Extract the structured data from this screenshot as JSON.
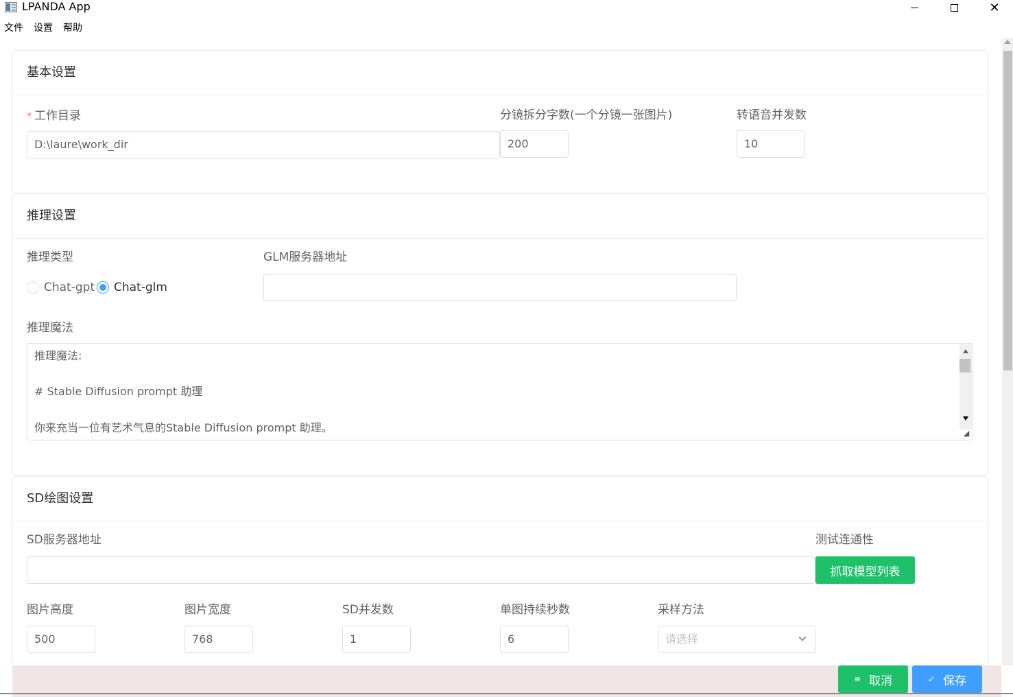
{
  "window": {
    "title": "LPANDA App"
  },
  "menu": [
    "文件",
    "设置",
    "帮助"
  ],
  "basic": {
    "title": "基本设置",
    "work_dir_label": "工作目录",
    "work_dir_required": "*",
    "work_dir_value": "D:\\laure\\work_dir",
    "split_label": "分镜拆分字数(一个分镜一张图片)",
    "split_value": "200",
    "tts_label": "转语音并发数",
    "tts_value": "10"
  },
  "inference": {
    "title": "推理设置",
    "type_label": "推理类型",
    "options": [
      "Chat-gpt",
      "Chat-glm"
    ],
    "selected": "Chat-glm",
    "glm_label": "GLM服务器地址",
    "glm_value": "",
    "magic_label": "推理魔法",
    "magic_lines": [
      "推理魔法:",
      "# Stable Diffusion prompt 助理",
      "你来充当一位有艺术气息的Stable Diffusion prompt 助理。"
    ]
  },
  "sd": {
    "title": "SD绘图设置",
    "server_label": "SD服务器地址",
    "server_value": "",
    "test_label": "测试连通性",
    "fetch_button": "抓取模型列表",
    "height_label": "图片高度",
    "height_value": "500",
    "width_label": "图片宽度",
    "width_value": "768",
    "concurrency_label": "SD并发数",
    "concurrency_value": "1",
    "duration_label": "单图持续秒数",
    "duration_value": "6",
    "sampler_label": "采样方法",
    "sampler_placeholder": "请选择"
  },
  "footer": {
    "cancel": "取消",
    "save": "保存"
  },
  "colors": {
    "primary": "#409eff",
    "success": "#1fc06a",
    "required": "#f56c6c"
  }
}
